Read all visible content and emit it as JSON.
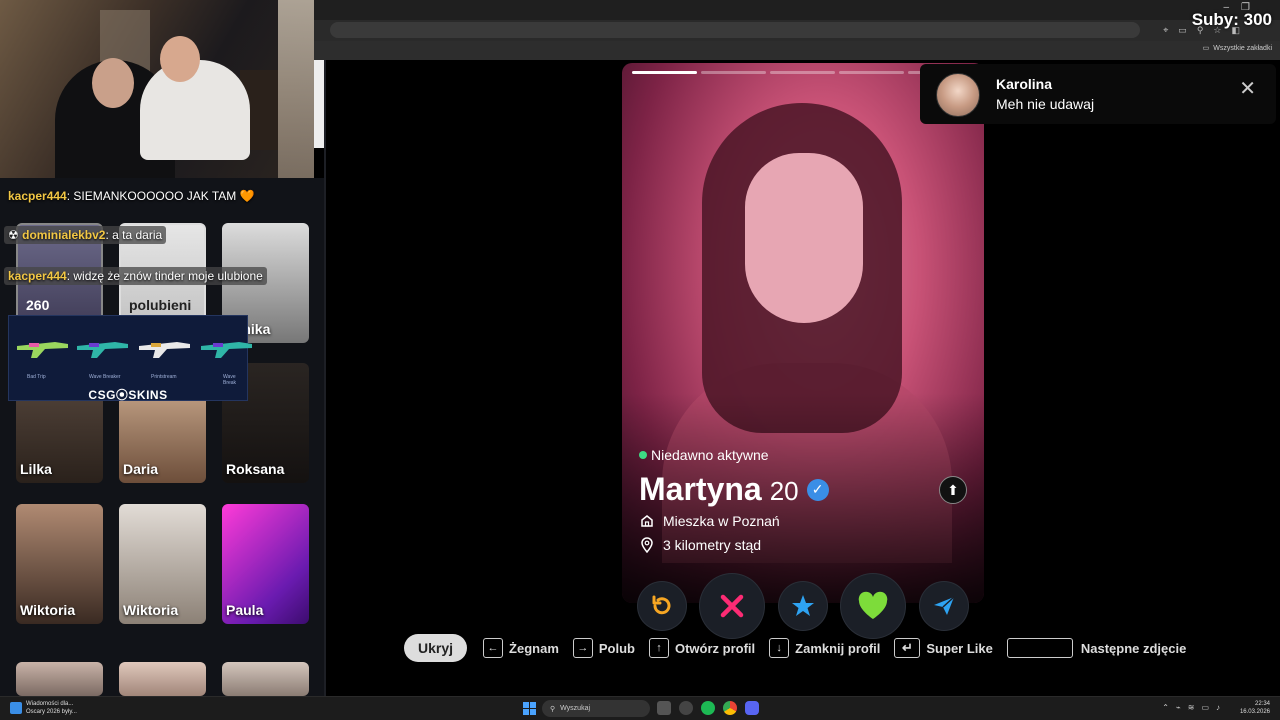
{
  "stream_overlay": {
    "subs_counter": "Suby: 300"
  },
  "browser": {
    "bookmarks_folder": "Wszystkie zakładki"
  },
  "chat": [
    {
      "user": "kacper444",
      "message": "SIEMANKOOOOOO JAK TAM 🧡"
    },
    {
      "user": "dominialekbv2",
      "message": "a ta daria"
    },
    {
      "user": "kacper444",
      "message": "widzę że znów tinder moje ulubione"
    }
  ],
  "likes_grid": {
    "tile_count": "260",
    "top_picks_label": "polubieni",
    "cards": [
      {
        "name": "minika"
      },
      {
        "name": "Lilka"
      },
      {
        "name": "Daria"
      },
      {
        "name": "Roksana"
      },
      {
        "name": "Wiktoria"
      },
      {
        "name": "Wiktoria"
      },
      {
        "name": "Paula"
      }
    ]
  },
  "sponsor": {
    "logo": "CSG⦿SKINS",
    "skins": [
      "Bad Trip",
      "Wave Breaker",
      "Printstream",
      "Wave Break"
    ]
  },
  "profile": {
    "status": "Niedawno aktywne",
    "name": "Martyna",
    "age": "20",
    "lives_in": "Mieszka w Poznań",
    "distance": "3 kilometry stąd",
    "photo_count": 5,
    "active_photo": 0
  },
  "actions": {
    "rewind_icon": "rewind-icon",
    "nope_icon": "x-icon",
    "superlike_icon": "star-icon",
    "like_icon": "heart-icon",
    "boost_icon": "send-icon"
  },
  "hints": {
    "hide": "Ukryj",
    "nope": "Żegnam",
    "like": "Polub",
    "open_profile": "Otwórz profil",
    "close_profile": "Zamknij profil",
    "super_like": "Super Like",
    "next_photo": "Następne zdjęcie"
  },
  "notification": {
    "name": "Karolina",
    "message": "Meh nie udawaj"
  },
  "taskbar": {
    "news_line1": "Wiadomości dla...",
    "news_line2": "Oscary 2026 były...",
    "search_placeholder": "Wyszukaj",
    "time": "22:34",
    "date": "16.03.2026"
  },
  "colors": {
    "accent_pink": "#fd2b74",
    "like_green": "#7ddc3a",
    "superlike_blue": "#2ea3f2",
    "rewind_orange": "#f6a623",
    "verified_blue": "#3a8ee6"
  }
}
